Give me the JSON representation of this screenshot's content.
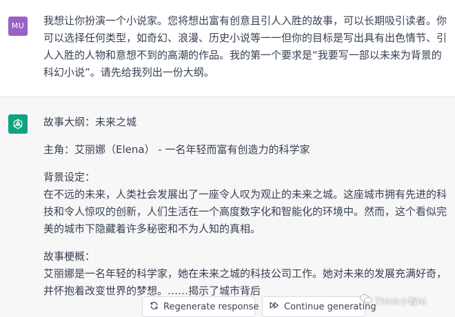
{
  "user_message": {
    "avatar_initials": "MU",
    "text": "我想让你扮演一个小说家。您将想出富有创意且引人入胜的故事，可以长期吸引读者。你可以选择任何类型，如奇幻、浪漫、历史小说等一一但你的目标是写出具有出色情节、引人入胜的人物和意想不到的高潮的作品。我的第一个要求是“我要写一部以未来为背景的科幻小说”。请先给我列出一份大纲。"
  },
  "assistant_message": {
    "avatar_icon": "openai-logo-icon",
    "outline_title": "故事大纲：未来之城",
    "protagonist": "主角：艾丽娜（Elena） - 一名年轻而富有创造力的科学家",
    "setting_heading": "背景设定：",
    "setting_text": "在不远的未来，人类社会发展出了一座令人叹为观止的未来之城。这座城市拥有先进的科技和令人惊叹的创新，人们生活在一个高度数字化和智能化的环境中。然而，这个看似完美的城市下隐藏着许多秘密和不为人知的真相。",
    "summary_heading": "故事梗概：",
    "summary_text": "艾丽娜是一名年轻的科学家，她在未来之城的科技公司工作。她对未来的发展充满好奇，并怀抱着改变世界的梦想。……揭示了城市背后"
  },
  "actions": {
    "regenerate_label": "Regenerate response",
    "continue_label": "Continue generating"
  },
  "watermark": {
    "text": "Think小智AI"
  },
  "colors": {
    "user_avatar": "#9a62c4",
    "assistant_avatar": "#10a37f",
    "assistant_bg": "#f7f7f8"
  }
}
